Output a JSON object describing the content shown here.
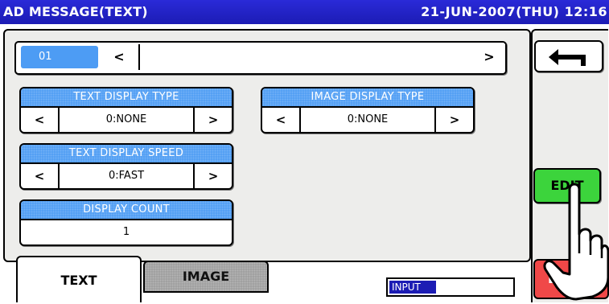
{
  "header": {
    "title": "AD MESSAGE(TEXT)",
    "datetime": "21-JUN-2007(THU) 12:16"
  },
  "message_selector": {
    "number": "01",
    "prev_label": "<",
    "next_label": ">",
    "value": ""
  },
  "text_display_type": {
    "label": "TEXT DISPLAY TYPE",
    "value": "0:NONE",
    "prev_label": "<",
    "next_label": ">"
  },
  "image_display_type": {
    "label": "IMAGE DISPLAY TYPE",
    "value": "0:NONE",
    "prev_label": "<",
    "next_label": ">"
  },
  "text_display_speed": {
    "label": "TEXT DISPLAY SPEED",
    "value": "0:FAST",
    "prev_label": "<",
    "next_label": ">"
  },
  "display_count": {
    "label": "DISPLAY COUNT",
    "value": "1"
  },
  "tabs": [
    {
      "label": "TEXT",
      "active": true
    },
    {
      "label": "IMAGE",
      "active": false
    }
  ],
  "input_indicator": {
    "label": "INPUT"
  },
  "buttons": {
    "back": "back-arrow-icon",
    "edit": "EDIT",
    "delete": "DELETE"
  },
  "colors": {
    "title_bar": "#1c1cb4",
    "field_header": "#4d9cf4",
    "edit_button": "#3cd43c",
    "delete_button": "#f04848"
  }
}
